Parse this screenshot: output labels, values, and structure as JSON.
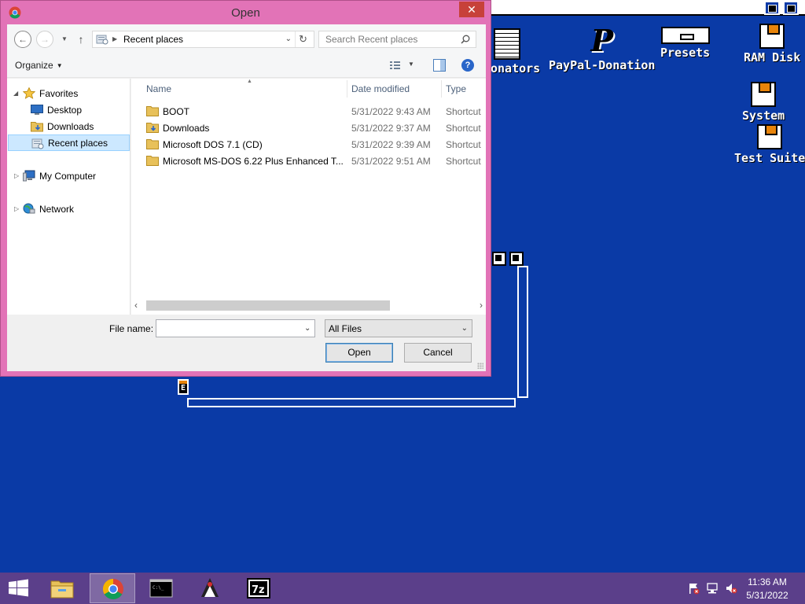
{
  "desktop": {
    "icons": [
      {
        "label": "onators"
      },
      {
        "label": "PayPal-Donation"
      },
      {
        "label": "Presets"
      },
      {
        "label": "RAM Disk"
      },
      {
        "label": "System"
      },
      {
        "label": "Test Suite"
      }
    ],
    "amiga_window_gadget": "E"
  },
  "dialog": {
    "title": "Open",
    "close_glyph": "✕",
    "nav": {
      "back_glyph": "←",
      "forward_glyph": "→",
      "up_glyph": "↑",
      "location": "Recent places",
      "search_placeholder": "Search Recent places"
    },
    "toolbar": {
      "organize_label": "Organize",
      "help_glyph": "?"
    },
    "sidebar": {
      "items": [
        {
          "label": "Favorites",
          "icon": "star-icon"
        },
        {
          "label": "Desktop",
          "icon": "desktop-icon"
        },
        {
          "label": "Downloads",
          "icon": "downloads-folder-icon"
        },
        {
          "label": "Recent places",
          "icon": "recent-places-icon",
          "selected": true
        },
        {
          "label": "My Computer",
          "icon": "computer-icon"
        },
        {
          "label": "Network",
          "icon": "network-icon"
        }
      ]
    },
    "columns": {
      "name": "Name",
      "date": "Date modified",
      "type": "Type"
    },
    "files": [
      {
        "name": "BOOT",
        "date": "5/31/2022 9:43 AM",
        "type": "Shortcut"
      },
      {
        "name": "Downloads",
        "date": "5/31/2022 9:37 AM",
        "type": "Shortcut"
      },
      {
        "name": "Microsoft DOS 7.1 (CD)",
        "date": "5/31/2022 9:39 AM",
        "type": "Shortcut"
      },
      {
        "name": "Microsoft MS-DOS 6.22 Plus Enhanced T...",
        "date": "5/31/2022 9:51 AM",
        "type": "Shortcut"
      }
    ],
    "footer": {
      "filename_label": "File name:",
      "filename_value": "",
      "filetype_value": "All Files",
      "open_label": "Open",
      "cancel_label": "Cancel"
    }
  },
  "taskbar": {
    "apps": [
      {
        "name": "file-explorer-icon",
        "active": false
      },
      {
        "name": "chrome-icon",
        "active": true
      },
      {
        "name": "command-prompt-icon",
        "active": false
      },
      {
        "name": "java-duke-icon",
        "active": false
      },
      {
        "name": "7zip-icon",
        "active": false
      }
    ],
    "clock_time": "11:36 AM",
    "clock_date": "5/31/2022"
  },
  "colors": {
    "desktop_bg": "#0a3aa6",
    "dialog_frame": "#e273b7",
    "taskbar_bg": "#5b3f8a",
    "selection_bg": "#cce8ff",
    "close_red": "#c7413a"
  }
}
